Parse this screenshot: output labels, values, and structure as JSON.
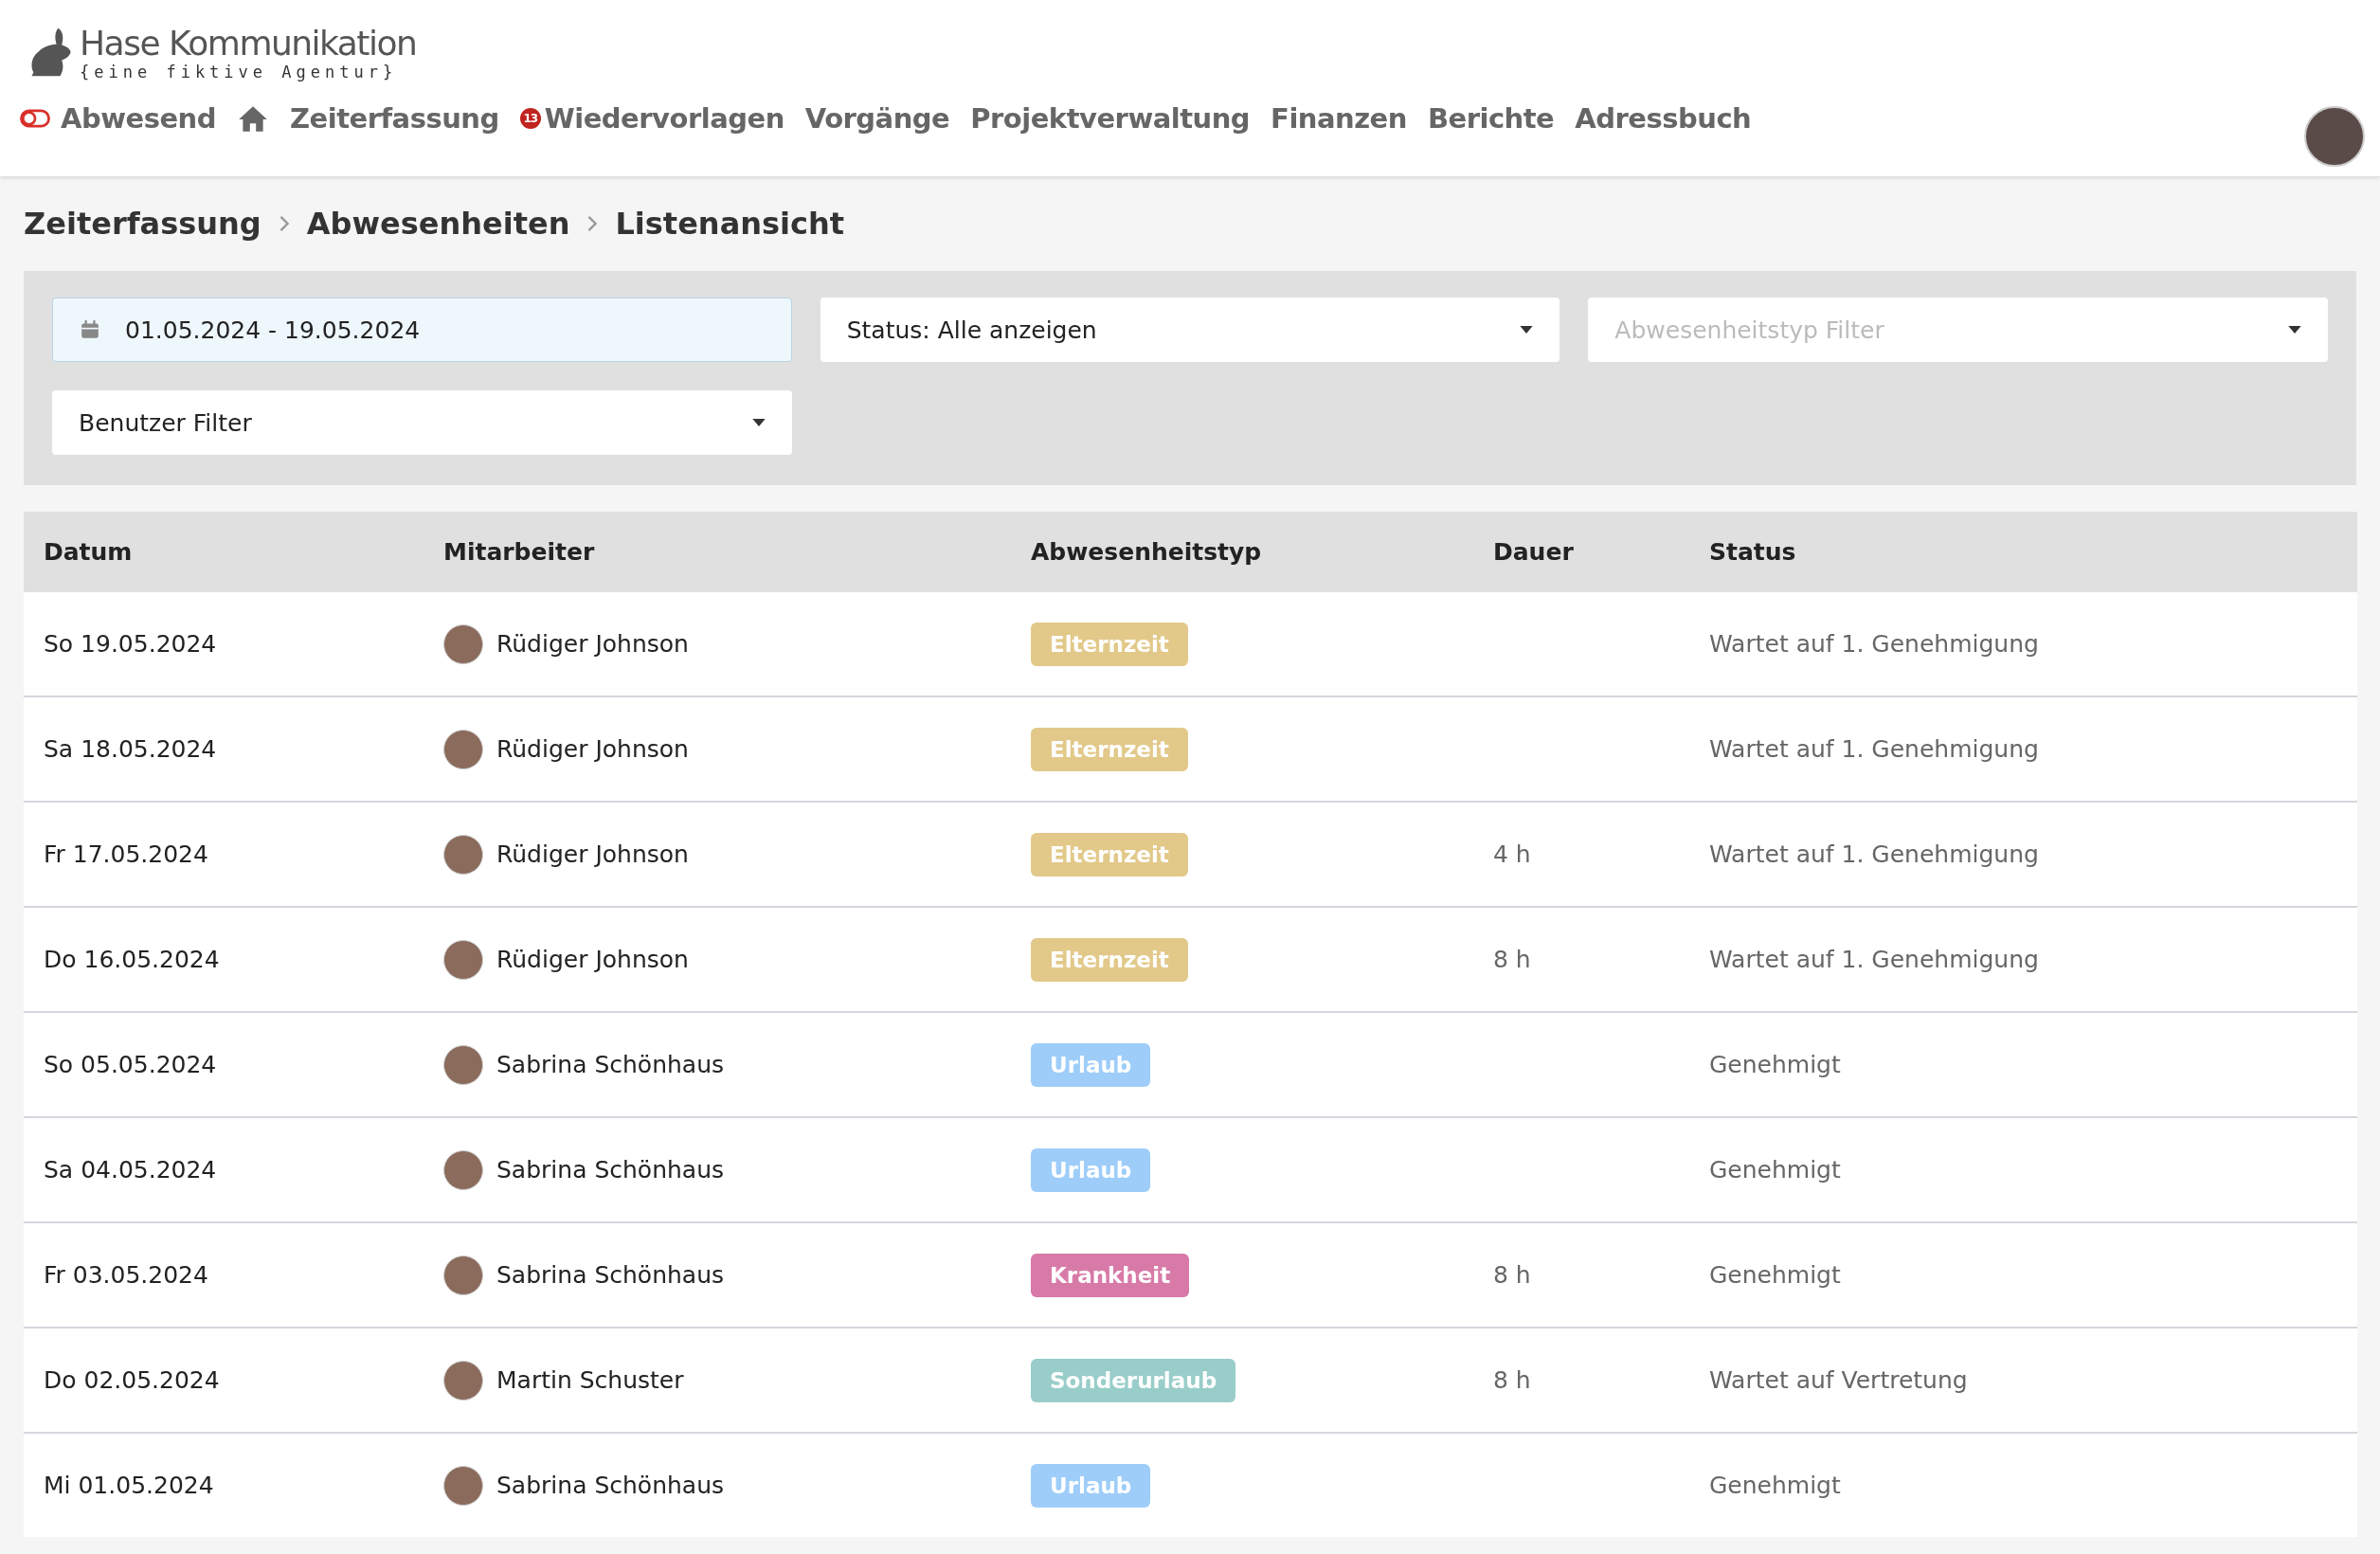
{
  "logo": {
    "name": "Hase Kommunikation",
    "tagline": "{eine fiktive Agentur}"
  },
  "nav": [
    {
      "kind": "status",
      "label": "Abwesend"
    },
    {
      "kind": "home"
    },
    {
      "kind": "link",
      "label": "Zeiterfassung"
    },
    {
      "kind": "badge",
      "label": "Wiedervorlagen",
      "badge": "13"
    },
    {
      "kind": "link",
      "label": "Vorgänge"
    },
    {
      "kind": "link",
      "label": "Projektverwaltung"
    },
    {
      "kind": "link",
      "label": "Finanzen"
    },
    {
      "kind": "link",
      "label": "Berichte"
    },
    {
      "kind": "link",
      "label": "Adressbuch"
    }
  ],
  "breadcrumb": [
    "Zeiterfassung",
    "Abwesenheiten",
    "Listenansicht"
  ],
  "filters": {
    "date_range": {
      "value": "01.05.2024 - 19.05.2024"
    },
    "status": {
      "value": "Status: Alle anzeigen"
    },
    "type": {
      "placeholder": "Abwesenheitstyp Filter"
    },
    "user": {
      "value": "Benutzer Filter"
    }
  },
  "table": {
    "columns": [
      "Datum",
      "Mitarbeiter",
      "Abwesenheitstyp",
      "Dauer",
      "Status"
    ],
    "rows": [
      {
        "date": "So 19.05.2024",
        "employee": "Rüdiger Johnson",
        "type": "Elternzeit",
        "color": "#e2c98a",
        "duration": "",
        "status": "Wartet auf 1. Genehmigung"
      },
      {
        "date": "Sa 18.05.2024",
        "employee": "Rüdiger Johnson",
        "type": "Elternzeit",
        "color": "#e2c98a",
        "duration": "",
        "status": "Wartet auf 1. Genehmigung"
      },
      {
        "date": "Fr 17.05.2024",
        "employee": "Rüdiger Johnson",
        "type": "Elternzeit",
        "color": "#e2c98a",
        "duration": "4 h",
        "status": "Wartet auf 1. Genehmigung"
      },
      {
        "date": "Do 16.05.2024",
        "employee": "Rüdiger Johnson",
        "type": "Elternzeit",
        "color": "#e2c98a",
        "duration": "8 h",
        "status": "Wartet auf 1. Genehmigung"
      },
      {
        "date": "So 05.05.2024",
        "employee": "Sabrina Schönhaus",
        "type": "Urlaub",
        "color": "#9ecdf9",
        "duration": "",
        "status": "Genehmigt"
      },
      {
        "date": "Sa 04.05.2024",
        "employee": "Sabrina Schönhaus",
        "type": "Urlaub",
        "color": "#9ecdf9",
        "duration": "",
        "status": "Genehmigt"
      },
      {
        "date": "Fr 03.05.2024",
        "employee": "Sabrina Schönhaus",
        "type": "Krankheit",
        "color": "#d87aa8",
        "duration": "8 h",
        "status": "Genehmigt"
      },
      {
        "date": "Do 02.05.2024",
        "employee": "Martin Schuster",
        "type": "Sonderurlaub",
        "color": "#99cdc9",
        "duration": "8 h",
        "status": "Wartet auf Vertretung"
      },
      {
        "date": "Mi 01.05.2024",
        "employee": "Sabrina Schönhaus",
        "type": "Urlaub",
        "color": "#9ecdf9",
        "duration": "",
        "status": "Genehmigt"
      }
    ]
  }
}
